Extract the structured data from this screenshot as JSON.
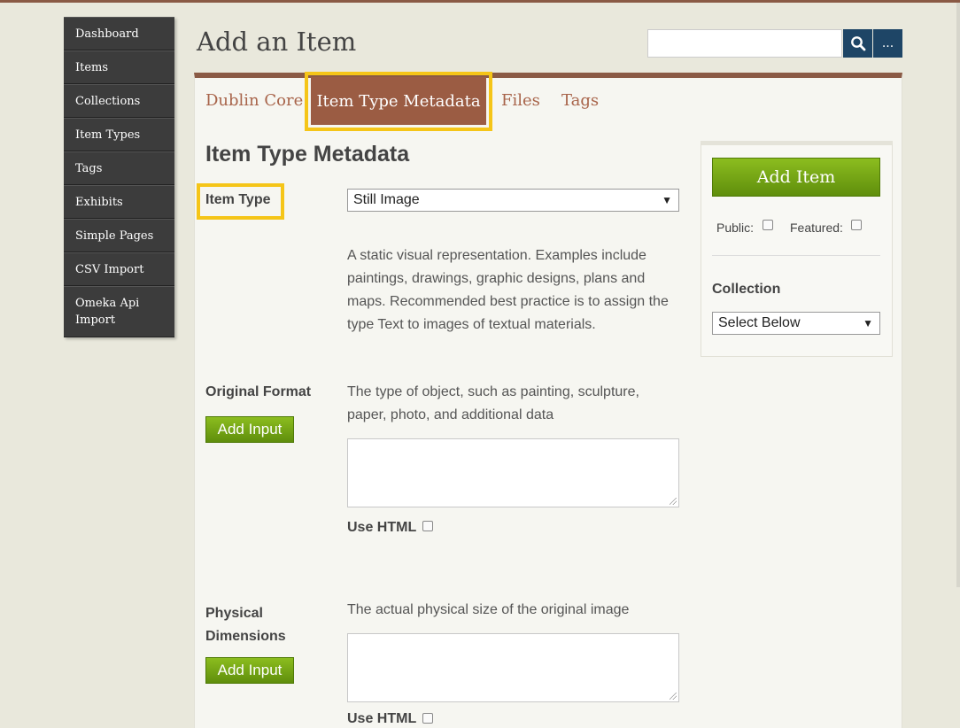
{
  "sidebar": {
    "items": [
      {
        "label": "Dashboard"
      },
      {
        "label": "Items"
      },
      {
        "label": "Collections"
      },
      {
        "label": "Item Types"
      },
      {
        "label": "Tags"
      },
      {
        "label": "Exhibits"
      },
      {
        "label": "Simple Pages"
      },
      {
        "label": "CSV Import"
      },
      {
        "label": "Omeka Api Import"
      }
    ]
  },
  "header": {
    "title": "Add an Item",
    "search_value": "",
    "search_icon": "search-icon",
    "more_label": "..."
  },
  "tabs": [
    {
      "label": "Dublin Core"
    },
    {
      "label": "Item Type Metadata",
      "active": true
    },
    {
      "label": "Files"
    },
    {
      "label": "Tags"
    }
  ],
  "form": {
    "section_title": "Item Type Metadata",
    "item_type": {
      "label": "Item Type",
      "selected": "Still Image",
      "description": "A static visual representation. Examples include paintings, drawings, graphic designs, plans and maps. Recommended best practice is to assign the type Text to images of textual materials."
    },
    "original_format": {
      "label": "Original Format",
      "add_input": "Add Input",
      "description": "The type of object, such as painting, sculpture, paper, photo, and additional data",
      "value": "",
      "use_html": "Use HTML"
    },
    "physical_dimensions": {
      "label": "Physical Dimensions",
      "add_input": "Add Input",
      "description": "The actual physical size of the original image",
      "value": "",
      "use_html": "Use HTML"
    }
  },
  "side": {
    "add_item": "Add Item",
    "public_label": "Public:",
    "featured_label": "Featured:",
    "collection_label": "Collection",
    "collection_selected": "Select Below"
  },
  "colors": {
    "accent": "#8a5a45",
    "active_tab": "#9b5c43",
    "highlight": "#f5c518",
    "button_green": "#6fa012",
    "nav_dark": "#3c3c3c",
    "search_blue": "#1e4566"
  }
}
